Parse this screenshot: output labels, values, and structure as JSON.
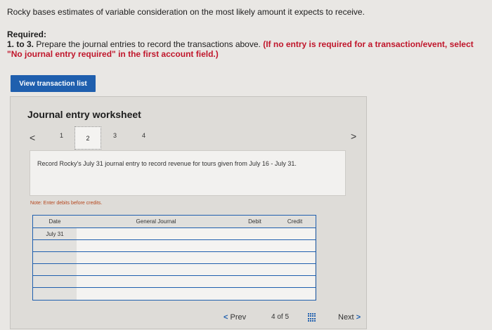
{
  "intro": "Rocky bases estimates of variable consideration on the most likely amount it expects to receive.",
  "required": {
    "heading": "Required:",
    "line_prefix": "1. to 3.",
    "line_text": " Prepare the journal entries to record the transactions above. ",
    "instruction": "(If no entry is required for a transaction/event, select \"No journal entry required\" in the first account field.)"
  },
  "view_button": "View transaction list",
  "worksheet": {
    "title": "Journal entry worksheet",
    "tabs": [
      "1",
      "2",
      "3",
      "4"
    ],
    "active_tab": "2",
    "description": "Record Rocky's July 31 journal entry to record revenue for tours given from July 16 - July 31.",
    "note": "Note: Enter debits before credits.",
    "table": {
      "headers": [
        "Date",
        "General Journal",
        "Debit",
        "Credit"
      ],
      "rows": [
        {
          "date": "July 31",
          "account": "",
          "debit": "",
          "credit": ""
        },
        {
          "date": "",
          "account": "",
          "debit": "",
          "credit": ""
        },
        {
          "date": "",
          "account": "",
          "debit": "",
          "credit": ""
        },
        {
          "date": "",
          "account": "",
          "debit": "",
          "credit": ""
        },
        {
          "date": "",
          "account": "",
          "debit": "",
          "credit": ""
        },
        {
          "date": "",
          "account": "",
          "debit": "",
          "credit": ""
        }
      ]
    }
  },
  "pager": {
    "prev": "Prev",
    "current": "4",
    "of": "of 5",
    "next": "Next"
  },
  "colors": {
    "accent": "#1f5fae",
    "red": "#c0162b",
    "note": "#b5471e"
  }
}
